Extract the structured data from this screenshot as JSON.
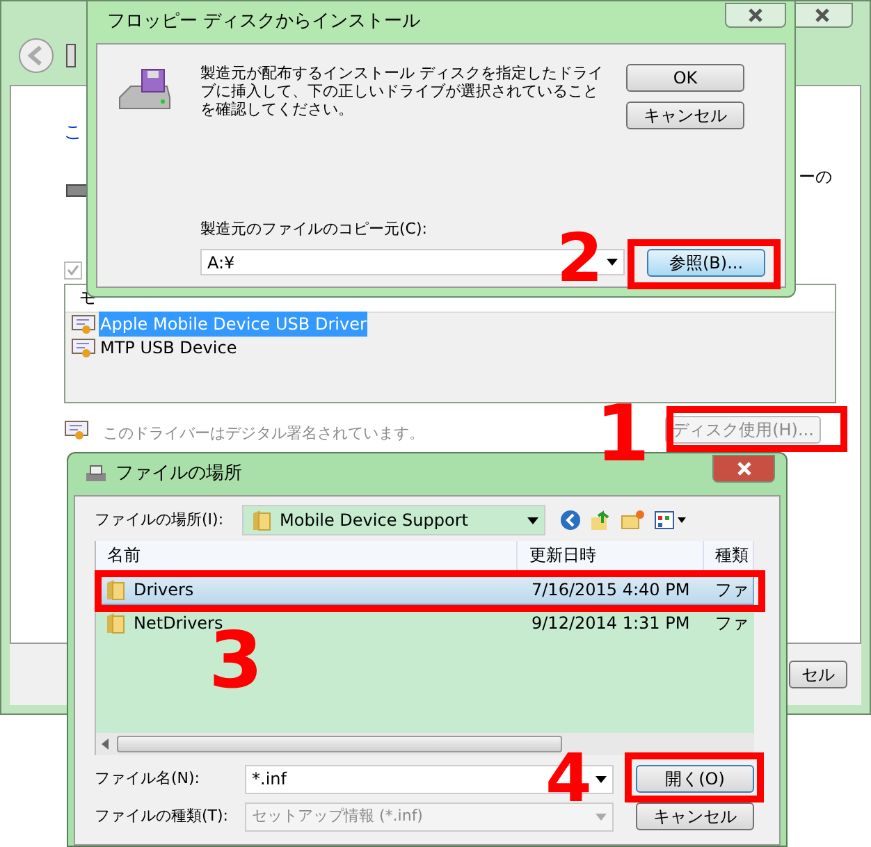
{
  "background_window": {
    "link_text": "こ",
    "partial_text": "ーの",
    "checkbox": {
      "checked": true
    },
    "list": {
      "header": "モ",
      "items": [
        {
          "label": "Apple Mobile Device USB Driver",
          "selected": true
        },
        {
          "label": "MTP USB Device",
          "selected": false
        }
      ]
    },
    "signature_text": "このドライバーはデジタル署名されています。",
    "have_disk_button": "ディスク使用(H)...",
    "cancel_button": "セル"
  },
  "install_dialog": {
    "title": "フロッピー ディスクからインストール",
    "message": "製造元が配布するインストール ディスクを指定したドライブに挿入して、下の正しいドライブが選択されていることを確認してください。",
    "ok_button": "OK",
    "cancel_button": "キャンセル",
    "copy_from_label": "製造元のファイルのコピー元(C):",
    "copy_from_value": "A:¥",
    "browse_button": "参照(B)..."
  },
  "file_dialog": {
    "title": "ファイルの場所",
    "look_in_label": "ファイルの場所(I):",
    "look_in_value": "Mobile Device Support",
    "columns": [
      "名前",
      "更新日時",
      "種類"
    ],
    "rows": [
      {
        "name": "Drivers",
        "modified": "7/16/2015 4:40 PM",
        "type": "ファ",
        "selected": true
      },
      {
        "name": "NetDrivers",
        "modified": "9/12/2014 1:31 PM",
        "type": "ファ",
        "selected": false
      }
    ],
    "file_name_label": "ファイル名(N):",
    "file_name_value": "*.inf",
    "file_type_label": "ファイルの種類(T):",
    "file_type_value": "セットアップ情報 (*.inf)",
    "open_button": "開く(O)",
    "cancel_button": "キャンセル"
  },
  "annotations": [
    "1",
    "2",
    "3",
    "4"
  ]
}
